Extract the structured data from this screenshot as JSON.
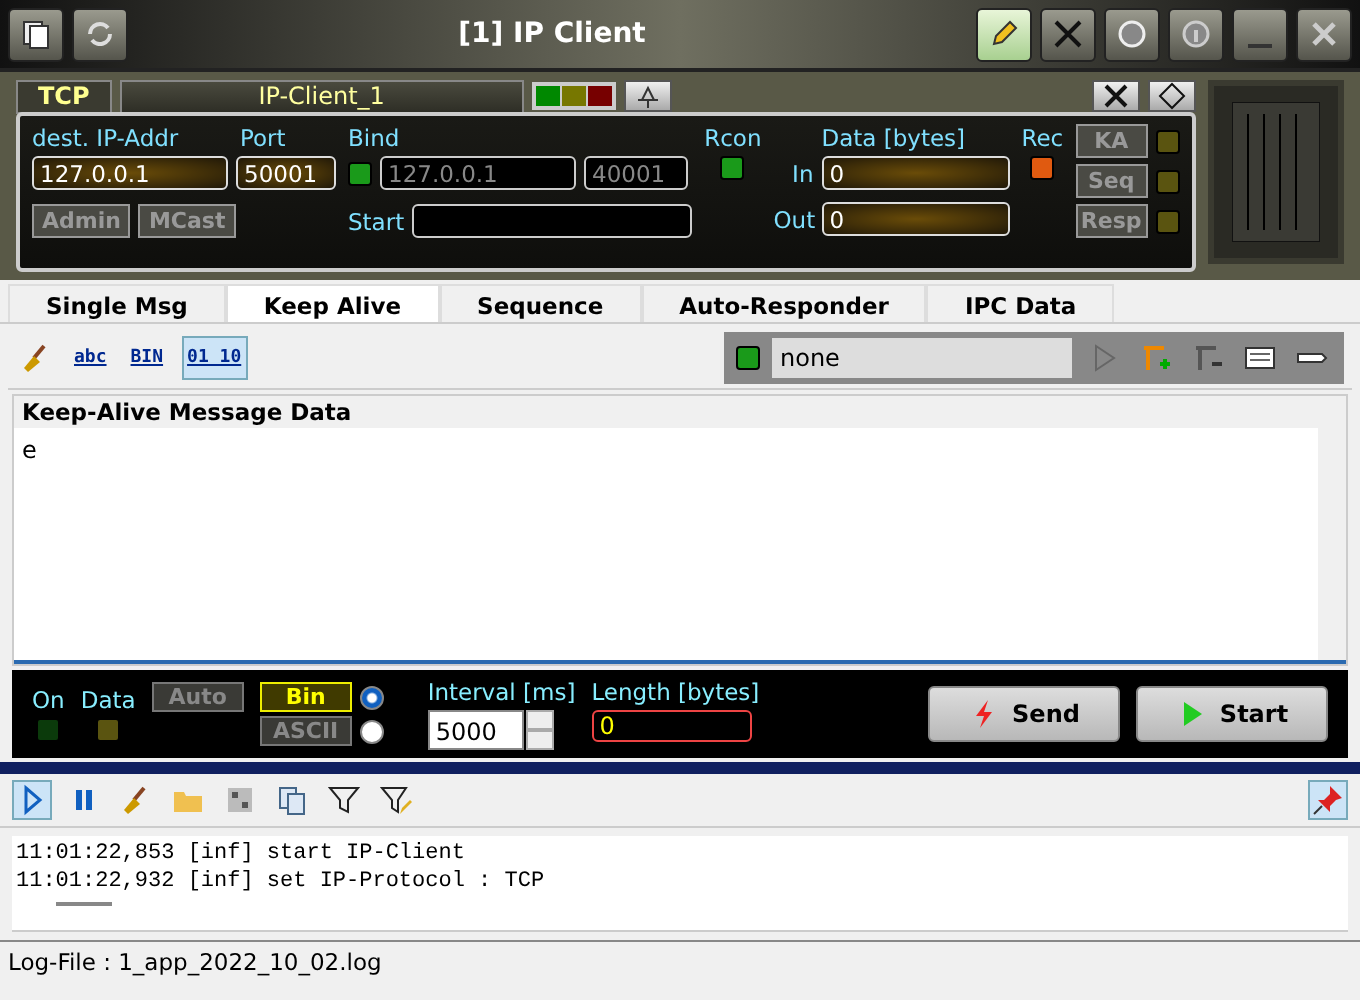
{
  "window": {
    "title": "[1] IP Client"
  },
  "connection": {
    "protocol": "TCP",
    "name": "IP-Client_1",
    "dest_label": "dest. IP-Addr",
    "dest_value": "127.0.0.1",
    "port_label": "Port",
    "port_value": "50001",
    "admin": "Admin",
    "mcast": "MCast",
    "bind_label": "Bind",
    "bind_on": true,
    "bind_ip": "127.0.0.1",
    "bind_port": "40001",
    "start_label": "Start",
    "rcon_label": "Rcon",
    "rcon_on": true,
    "data_label": "Data [bytes]",
    "in_label": "In",
    "in_value": "0",
    "out_label": "Out",
    "out_value": "0",
    "rec_label": "Rec",
    "rec_on": true,
    "flags": [
      {
        "label": "KA",
        "on": false
      },
      {
        "label": "Seq",
        "on": false
      },
      {
        "label": "Resp",
        "on": false
      }
    ]
  },
  "tabs": [
    {
      "label": "Single Msg",
      "selected": false
    },
    {
      "label": "Keep Alive",
      "selected": true
    },
    {
      "label": "Sequence",
      "selected": false
    },
    {
      "label": "Auto-Responder",
      "selected": false
    },
    {
      "label": "IPC Data",
      "selected": false
    }
  ],
  "format_buttons": [
    {
      "label": "abc",
      "selected": false
    },
    {
      "label": "BIN",
      "selected": false
    },
    {
      "label": "01 10",
      "selected": true
    }
  ],
  "selector": {
    "on": true,
    "value": "none"
  },
  "message": {
    "title": "Keep-Alive Message Data",
    "text": "e"
  },
  "keepalive": {
    "on_label": "On",
    "on": false,
    "data_label": "Data",
    "data": false,
    "auto": {
      "label": "Auto",
      "selected": false
    },
    "modes": [
      {
        "label": "Bin",
        "selected": true
      },
      {
        "label": "ASCII",
        "selected": false
      }
    ],
    "interval_label": "Interval [ms]",
    "interval": "5000",
    "length_label": "Length [bytes]",
    "length": "0",
    "send": "Send",
    "start": "Start"
  },
  "log_toolbar": {
    "play_selected": true,
    "pin_selected": true
  },
  "log": [
    "11:01:22,853 [inf] start IP-Client",
    "11:01:22,932 [inf] set IP-Protocol : TCP"
  ],
  "status_bar": "Log-File : 1_app_2022_10_02.log"
}
